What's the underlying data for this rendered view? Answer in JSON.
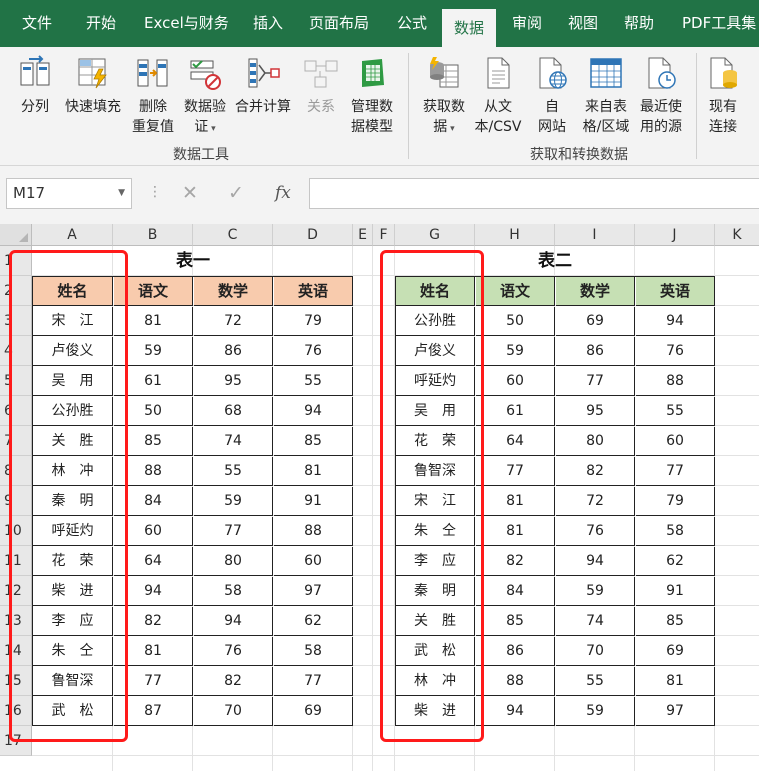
{
  "menu": {
    "tabs": [
      "文件",
      "开始",
      "Excel与财务",
      "插入",
      "页面布局",
      "公式",
      "数据",
      "审阅",
      "视图",
      "帮助",
      "PDF工具集"
    ],
    "active": "数据"
  },
  "ribbon": {
    "group1_label": "数据工具",
    "group2_label": "获取和转换数据",
    "buttons": {
      "split": "分列",
      "flash_fill": "快速填充",
      "remove_dup_1": "删除",
      "remove_dup_2": "重复值",
      "validation_1": "数据验",
      "validation_2": "证",
      "consolidate": "合并计算",
      "relations": "关系",
      "model_1": "管理数",
      "model_2": "据模型",
      "get_data_1": "获取数",
      "get_data_2": "据",
      "from_csv_1": "从文",
      "from_csv_2": "本/CSV",
      "from_web_1": "自",
      "from_web_2": "网站",
      "from_table_1": "来自表",
      "from_table_2": "格/区域",
      "recent_1": "最近使",
      "recent_2": "用的源",
      "existing_1": "现有",
      "existing_2": "连接"
    }
  },
  "formula_bar": {
    "name_box": "M17",
    "cancel_glyph": "✕",
    "enter_glyph": "✓",
    "fx_glyph": "fx",
    "formula": ""
  },
  "grid": {
    "columns": [
      "A",
      "B",
      "C",
      "D",
      "E",
      "F",
      "G",
      "H",
      "I",
      "J",
      "K"
    ],
    "rows": [
      "1",
      "2",
      "3",
      "4",
      "5",
      "6",
      "7",
      "8",
      "9",
      "10",
      "11",
      "12",
      "13",
      "14",
      "15",
      "16",
      "17"
    ]
  },
  "table1": {
    "title": "表一",
    "headers": [
      "姓名",
      "语文",
      "数学",
      "英语"
    ],
    "rows": [
      [
        "宋　江",
        "81",
        "72",
        "79"
      ],
      [
        "卢俊义",
        "59",
        "86",
        "76"
      ],
      [
        "吴　用",
        "61",
        "95",
        "55"
      ],
      [
        "公孙胜",
        "50",
        "68",
        "94"
      ],
      [
        "关　胜",
        "85",
        "74",
        "85"
      ],
      [
        "林　冲",
        "88",
        "55",
        "81"
      ],
      [
        "秦　明",
        "84",
        "59",
        "91"
      ],
      [
        "呼延灼",
        "60",
        "77",
        "88"
      ],
      [
        "花　荣",
        "64",
        "80",
        "60"
      ],
      [
        "柴　进",
        "94",
        "58",
        "97"
      ],
      [
        "李　应",
        "82",
        "94",
        "62"
      ],
      [
        "朱　仝",
        "81",
        "76",
        "58"
      ],
      [
        "鲁智深",
        "77",
        "82",
        "77"
      ],
      [
        "武　松",
        "87",
        "70",
        "69"
      ]
    ]
  },
  "table2": {
    "title": "表二",
    "headers": [
      "姓名",
      "语文",
      "数学",
      "英语"
    ],
    "rows": [
      [
        "公孙胜",
        "50",
        "69",
        "94"
      ],
      [
        "卢俊义",
        "59",
        "86",
        "76"
      ],
      [
        "呼延灼",
        "60",
        "77",
        "88"
      ],
      [
        "吴　用",
        "61",
        "95",
        "55"
      ],
      [
        "花　荣",
        "64",
        "80",
        "60"
      ],
      [
        "鲁智深",
        "77",
        "82",
        "77"
      ],
      [
        "宋　江",
        "81",
        "72",
        "79"
      ],
      [
        "朱　仝",
        "81",
        "76",
        "58"
      ],
      [
        "李　应",
        "82",
        "94",
        "62"
      ],
      [
        "秦　明",
        "84",
        "59",
        "91"
      ],
      [
        "关　胜",
        "85",
        "74",
        "85"
      ],
      [
        "武　松",
        "86",
        "70",
        "69"
      ],
      [
        "林　冲",
        "88",
        "55",
        "81"
      ],
      [
        "柴　进",
        "94",
        "59",
        "97"
      ]
    ]
  },
  "colors": {
    "menu_bg": "#217346",
    "table1_header_bg": "#f8cbad",
    "table2_header_bg": "#c6e0b4",
    "highlight_box": "#ff1a1a"
  }
}
